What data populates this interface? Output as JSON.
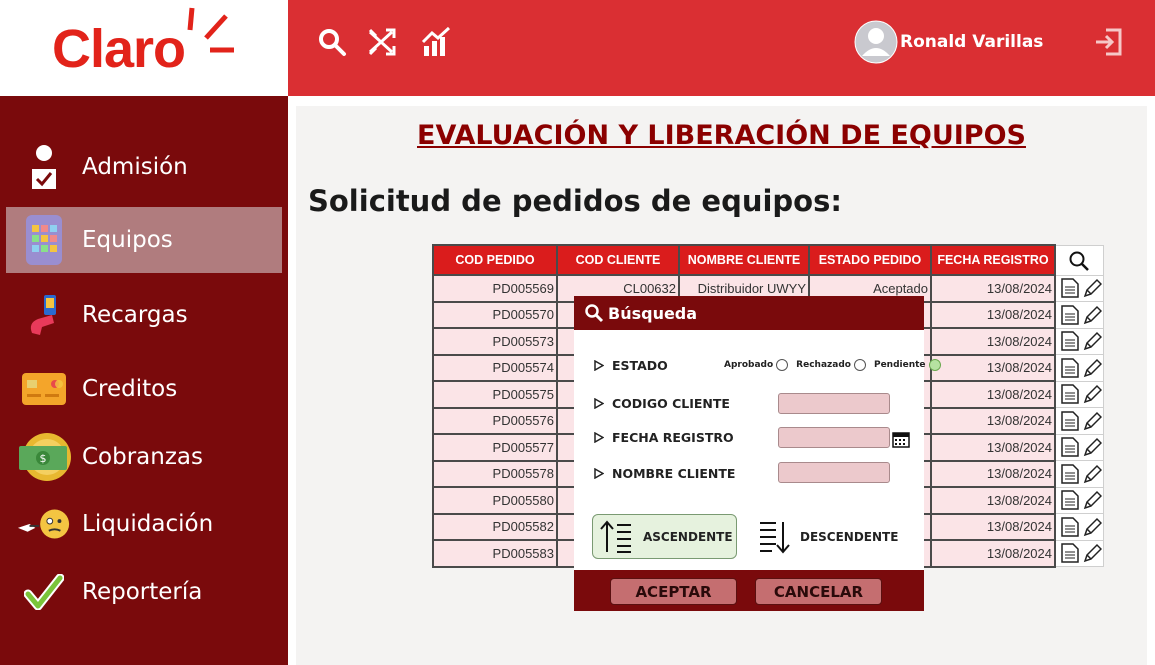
{
  "brand": {
    "logo_text": "Claro",
    "accent": "#da2f33",
    "dark": "#7a0a0c"
  },
  "topbar": {
    "icons": [
      "search-icon",
      "shuffle-icon",
      "chart-icon"
    ],
    "user_name": "Ronald Varillas",
    "logout_icon": "logout-icon"
  },
  "sidebar": {
    "items": [
      {
        "label": "Admisión",
        "icon": "admission-icon",
        "active": false
      },
      {
        "label": "Equipos",
        "icon": "devices-icon",
        "active": true
      },
      {
        "label": "Recargas",
        "icon": "recharge-icon",
        "active": false
      },
      {
        "label": "Creditos",
        "icon": "credit-card-icon",
        "active": false
      },
      {
        "label": "Cobranzas",
        "icon": "money-icon",
        "active": false
      },
      {
        "label": "Liquidación",
        "icon": "liquidation-icon",
        "active": false
      },
      {
        "label": "Reportería",
        "icon": "check-icon",
        "active": false
      }
    ]
  },
  "main": {
    "title": "EVALUACIÓN Y LIBERACIÓN DE EQUIPOS",
    "subtitle": "Solicitud de pedidos de equipos:"
  },
  "table": {
    "columns": [
      "COD PEDIDO",
      "COD CLIENTE",
      "NOMBRE CLIENTE",
      "ESTADO PEDIDO",
      "FECHA REGISTRO"
    ],
    "rows": [
      [
        "PD005569",
        "CL00632",
        "Distribuidor UWYY",
        "Aceptado",
        "13/08/2024"
      ],
      [
        "PD005570",
        "",
        "",
        "",
        "13/08/2024"
      ],
      [
        "PD005573",
        "",
        "",
        "",
        "13/08/2024"
      ],
      [
        "PD005574",
        "",
        "",
        "",
        "13/08/2024"
      ],
      [
        "PD005575",
        "",
        "",
        "",
        "13/08/2024"
      ],
      [
        "PD005576",
        "",
        "",
        "",
        "13/08/2024"
      ],
      [
        "PD005577",
        "",
        "",
        "",
        "13/08/2024"
      ],
      [
        "PD005578",
        "",
        "",
        "",
        "13/08/2024"
      ],
      [
        "PD005580",
        "",
        "",
        "",
        "13/08/2024"
      ],
      [
        "PD005582",
        "",
        "",
        "",
        "13/08/2024"
      ],
      [
        "PD005583",
        "",
        "",
        "",
        "13/08/2024"
      ]
    ]
  },
  "modal": {
    "title": "Búsqueda",
    "fields": {
      "estado": "ESTADO",
      "codigo_cliente": "CODIGO CLIENTE",
      "fecha_registro": "FECHA REGISTRO",
      "nombre_cliente": "NOMBRE CLIENTE"
    },
    "radio_options": [
      "Aprobado",
      "Rechazado",
      "Pendiente"
    ],
    "radio_selected": "Pendiente",
    "values": {
      "codigo_cliente": "",
      "fecha_registro": "",
      "nombre_cliente": ""
    },
    "sort": {
      "asc_label": "ASCENDENTE",
      "desc_label": "DESCENDENTE",
      "selected": "ASCENDENTE"
    },
    "buttons": {
      "accept": "ACEPTAR",
      "cancel": "CANCELAR"
    }
  }
}
